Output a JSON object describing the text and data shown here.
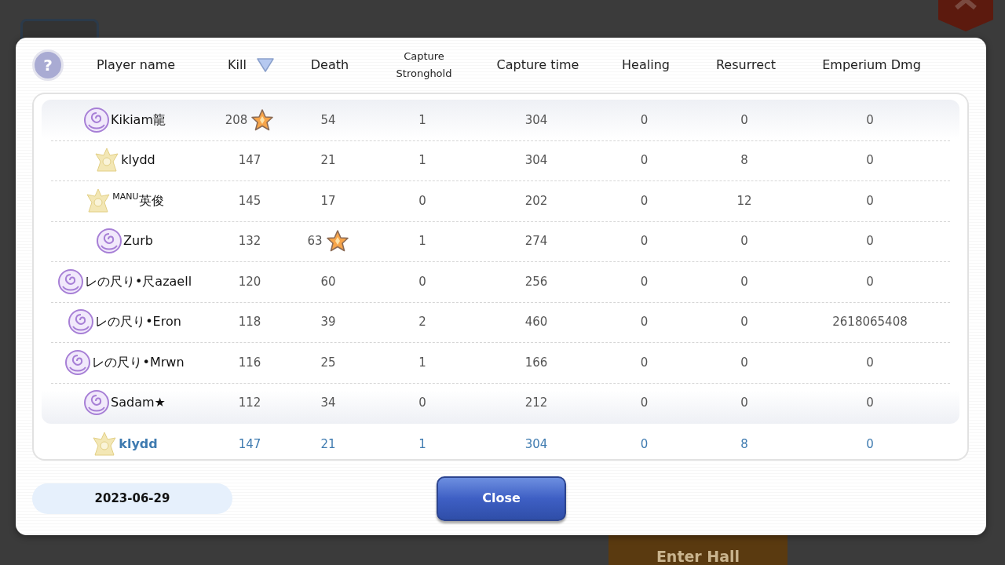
{
  "background": {
    "button": "Enter Hall"
  },
  "help_button": "?",
  "columns": [
    {
      "label": "Player name",
      "sorted": false
    },
    {
      "label": "Kill",
      "sorted": true
    },
    {
      "label": "Death",
      "sorted": false
    },
    {
      "label": "Capture Stronghold",
      "sorted": false
    },
    {
      "label": "Capture time",
      "sorted": false
    },
    {
      "label": "Healing",
      "sorted": false
    },
    {
      "label": "Resurrect",
      "sorted": false
    },
    {
      "label": "Emperium Dmg",
      "sorted": false
    }
  ],
  "rows": [
    {
      "kind": "rose",
      "name": "Kikiam龍",
      "kill": "208",
      "kill_star": true,
      "death": "54",
      "death_star": false,
      "capture_stronghold": "1",
      "capture_time": "304",
      "healing": "0",
      "resurrect": "0",
      "emperium_dmg": "0"
    },
    {
      "kind": "crest",
      "name": "klydd",
      "kill": "147",
      "kill_star": false,
      "death": "21",
      "death_star": false,
      "capture_stronghold": "1",
      "capture_time": "304",
      "healing": "0",
      "resurrect": "8",
      "emperium_dmg": "0"
    },
    {
      "kind": "crest",
      "name": "$^{MANU}$英俊",
      "kill": "145",
      "kill_star": false,
      "death": "17",
      "death_star": false,
      "capture_stronghold": "0",
      "capture_time": "202",
      "healing": "0",
      "resurrect": "12",
      "emperium_dmg": "0"
    },
    {
      "kind": "rose",
      "name": "Zurb",
      "kill": "132",
      "kill_star": false,
      "death": "63",
      "death_star": true,
      "capture_stronghold": "1",
      "capture_time": "274",
      "healing": "0",
      "resurrect": "0",
      "emperium_dmg": "0"
    },
    {
      "kind": "rose",
      "name": "レの尺り•尺azaell",
      "kill": "120",
      "kill_star": false,
      "death": "60",
      "death_star": false,
      "capture_stronghold": "0",
      "capture_time": "256",
      "healing": "0",
      "resurrect": "0",
      "emperium_dmg": "0"
    },
    {
      "kind": "rose",
      "name": "レの尺り•Eron",
      "kill": "118",
      "kill_star": false,
      "death": "39",
      "death_star": false,
      "capture_stronghold": "2",
      "capture_time": "460",
      "healing": "0",
      "resurrect": "0",
      "emperium_dmg": "2618065408"
    },
    {
      "kind": "rose",
      "name": "レの尺り•Mrwn",
      "kill": "116",
      "kill_star": false,
      "death": "25",
      "death_star": false,
      "capture_stronghold": "1",
      "capture_time": "166",
      "healing": "0",
      "resurrect": "0",
      "emperium_dmg": "0"
    },
    {
      "kind": "rose",
      "name": "Sadam★",
      "kill": "112",
      "kill_star": false,
      "death": "34",
      "death_star": false,
      "capture_stronghold": "0",
      "capture_time": "212",
      "healing": "0",
      "resurrect": "0",
      "emperium_dmg": "0"
    }
  ],
  "my_row": {
    "kind": "crest",
    "name": "klydd",
    "kill": "147",
    "death": "21",
    "capture_stronghold": "1",
    "capture_time": "304",
    "healing": "0",
    "resurrect": "8",
    "emperium_dmg": "0"
  },
  "date": "2023-06-29",
  "close_button": "Close"
}
